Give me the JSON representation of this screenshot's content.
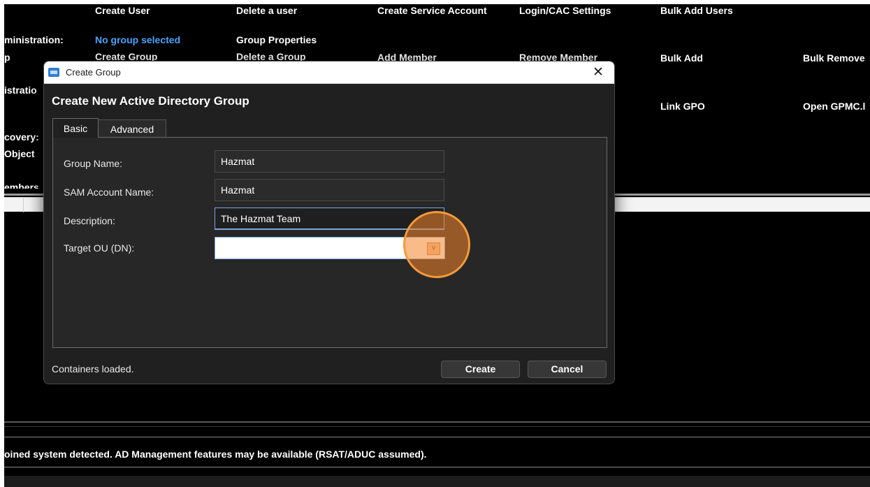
{
  "background": {
    "row1": [
      "Create User",
      "Delete a user",
      "Create Service Account",
      "Login/CAC Settings",
      "Bulk Add Users"
    ],
    "group_admin_label": "ministration:",
    "group_selected": "No group selected",
    "group_properties": "Group Properties",
    "row3_prefix": "p",
    "row3": [
      "Create Group",
      "Delete a Group",
      "Add Member",
      "Remove Member",
      "Bulk Add",
      "Bulk Remove"
    ],
    "gpo_label": "istratio",
    "gpo_actions": [
      "Link GPO",
      "Open GPMC.l"
    ],
    "discovery_label": "covery:",
    "object_label": "Object",
    "members_label": "embers",
    "status_message": "oined system detected. AD Management features may be available (RSAT/ADUC assumed)."
  },
  "dialog": {
    "title": "Create Group",
    "close_glyph": "✕",
    "heading": "Create New Active Directory Group",
    "tabs": [
      "Basic",
      "Advanced"
    ],
    "fields": {
      "group_name": {
        "label": "Group Name:",
        "value": "Hazmat"
      },
      "sam_account_name": {
        "label": "SAM Account Name:",
        "value": "Hazmat"
      },
      "description": {
        "label": "Description:",
        "value": "The Hazmat Team"
      },
      "target_ou": {
        "label": "Target OU (DN):",
        "value": "",
        "dropdown_glyph": "˅"
      }
    },
    "status": "Containers loaded.",
    "buttons": {
      "create": "Create",
      "cancel": "Cancel"
    }
  },
  "highlight_color": "#f28428",
  "icons": [
    "window-app-icon",
    "close-icon",
    "chevron-down-icon"
  ]
}
